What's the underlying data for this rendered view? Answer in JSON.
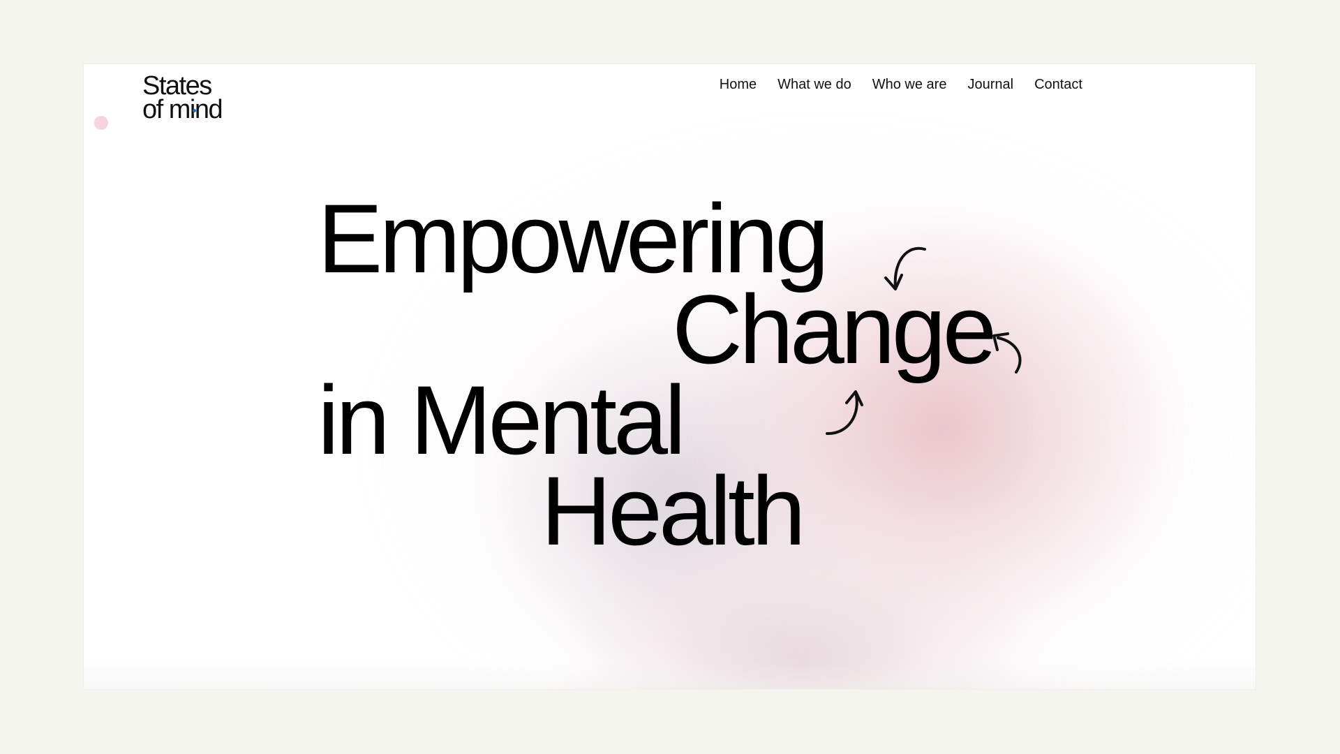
{
  "logo": {
    "line1": "States",
    "line2": "of mind"
  },
  "nav": {
    "items": [
      {
        "label": "Home"
      },
      {
        "label": "What we do"
      },
      {
        "label": "Who we are"
      },
      {
        "label": "Journal"
      },
      {
        "label": "Contact"
      }
    ]
  },
  "hero": {
    "line1": "Empowering",
    "line2": "Change",
    "line3": "in Mental",
    "line4": "Health"
  },
  "colors": {
    "page_background": "#f5f5f0",
    "frame_background": "#ffffff",
    "text": "#000000",
    "accent_pink": "#f6d3df",
    "logo_dot": "#1f6fb5",
    "blob_pink": "#e4b4bc",
    "blob_grey": "#cdc3cd"
  },
  "icons": [
    "hand-drawn-arrow-icon"
  ]
}
